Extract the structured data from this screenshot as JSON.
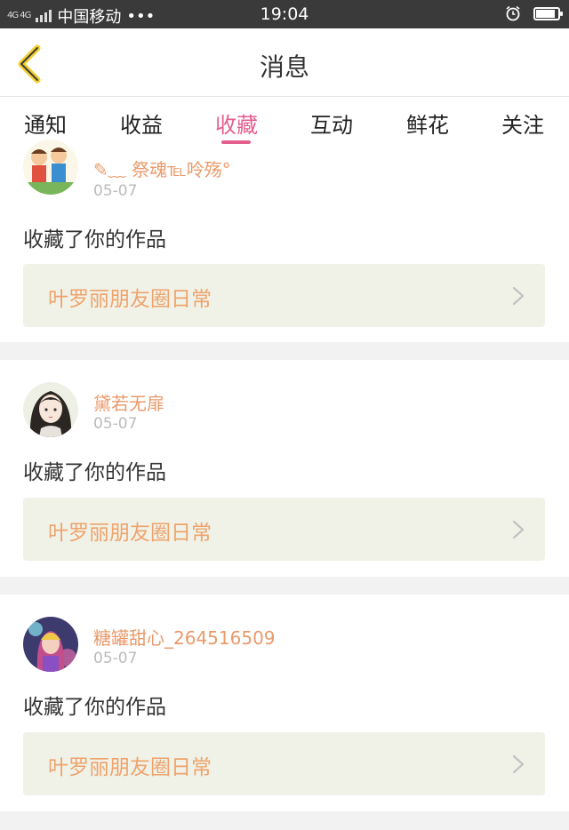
{
  "status_bar": {
    "network": "4G 4G",
    "carrier": "中国移动",
    "dots": "•••",
    "time": "19:04"
  },
  "header": {
    "title": "消息"
  },
  "tabs": [
    {
      "label": "通知",
      "active": false
    },
    {
      "label": "收益",
      "active": false
    },
    {
      "label": "收藏",
      "active": true
    },
    {
      "label": "互动",
      "active": false
    },
    {
      "label": "鲜花",
      "active": false
    },
    {
      "label": "关注",
      "active": false
    }
  ],
  "colors": {
    "accent_pink": "#e45e8e",
    "username_orange": "#e99a6b",
    "work_title_orange": "#eea36c",
    "work_bg": "#f0f2e8"
  },
  "messages": [
    {
      "username": "✎﹏ 祭魂℡呤殇°",
      "date": "05-07",
      "action": "收藏了你的作品",
      "work_title": "叶罗丽朋友圈日常",
      "avatar_icon": "cartoon-kids-avatar"
    },
    {
      "username": "黛若无扉",
      "date": "05-07",
      "action": "收藏了你的作品",
      "work_title": "叶罗丽朋友圈日常",
      "avatar_icon": "anime-girl-avatar"
    },
    {
      "username": "糖罐甜心_264516509",
      "date": "05-07",
      "action": "收藏了你的作品",
      "work_title": "叶罗丽朋友圈日常",
      "avatar_icon": "doll-avatar"
    }
  ]
}
